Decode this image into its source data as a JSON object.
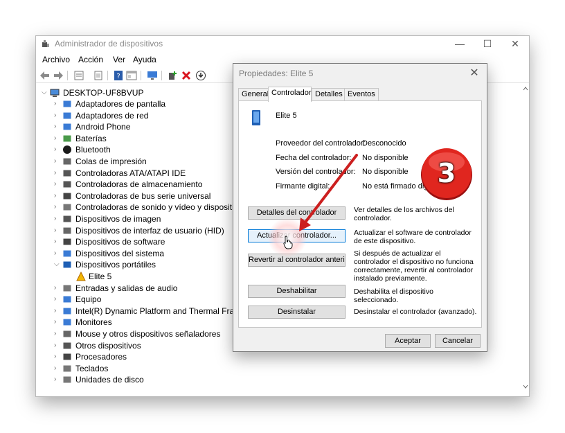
{
  "window": {
    "title": "Administrador de dispositivos",
    "minimize": "—",
    "maximize": "☐",
    "close": "✕"
  },
  "menu": [
    "Archivo",
    "Acción",
    "Ver",
    "Ayuda"
  ],
  "toolbar": {
    "icons": [
      "back-arrow-icon",
      "forward-arrow-icon",
      "properties-icon",
      "scan-icon",
      "help-icon",
      "view-icon",
      "monitor-icon",
      "add-driver-icon",
      "uninstall-icon",
      "update-icon"
    ]
  },
  "tree": {
    "root": "DESKTOP-UF8BVUP",
    "items": [
      {
        "label": "Adaptadores de pantalla",
        "icon": "display-adapter-icon",
        "expanded": false
      },
      {
        "label": "Adaptadores de red",
        "icon": "network-adapter-icon",
        "expanded": false
      },
      {
        "label": "Android Phone",
        "icon": "android-phone-icon",
        "expanded": false
      },
      {
        "label": "Baterías",
        "icon": "battery-icon",
        "expanded": false
      },
      {
        "label": "Bluetooth",
        "icon": "bluetooth-icon",
        "expanded": false
      },
      {
        "label": "Colas de impresión",
        "icon": "printer-icon",
        "expanded": false
      },
      {
        "label": "Controladoras ATA/ATAPI IDE",
        "icon": "ide-controller-icon",
        "expanded": false
      },
      {
        "label": "Controladoras de almacenamiento",
        "icon": "storage-controller-icon",
        "expanded": false
      },
      {
        "label": "Controladoras de bus serie universal",
        "icon": "usb-controller-icon",
        "expanded": false
      },
      {
        "label": "Controladoras de sonido y vídeo y dispositivos",
        "icon": "sound-icon",
        "expanded": false
      },
      {
        "label": "Dispositivos de imagen",
        "icon": "camera-icon",
        "expanded": false
      },
      {
        "label": "Dispositivos de interfaz de usuario (HID)",
        "icon": "hid-icon",
        "expanded": false
      },
      {
        "label": "Dispositivos de software",
        "icon": "software-device-icon",
        "expanded": false
      },
      {
        "label": "Dispositivos del sistema",
        "icon": "system-device-icon",
        "expanded": false
      },
      {
        "label": "Dispositivos portátiles",
        "icon": "portable-device-icon",
        "expanded": true
      },
      {
        "label": "Elite 5",
        "icon": "warning-device-icon",
        "child": true
      },
      {
        "label": "Entradas y salidas de audio",
        "icon": "speaker-icon",
        "expanded": false
      },
      {
        "label": "Equipo",
        "icon": "computer-icon",
        "expanded": false
      },
      {
        "label": "Intel(R) Dynamic Platform and Thermal Framework",
        "icon": "chip-icon",
        "expanded": false
      },
      {
        "label": "Monitores",
        "icon": "monitor-icon",
        "expanded": false
      },
      {
        "label": "Mouse y otros dispositivos señaladores",
        "icon": "mouse-icon",
        "expanded": false
      },
      {
        "label": "Otros dispositivos",
        "icon": "unknown-device-icon",
        "expanded": false
      },
      {
        "label": "Procesadores",
        "icon": "processor-icon",
        "expanded": false
      },
      {
        "label": "Teclados",
        "icon": "keyboard-icon",
        "expanded": false
      },
      {
        "label": "Unidades de disco",
        "icon": "disk-icon",
        "expanded": false
      }
    ]
  },
  "dialog": {
    "title": "Propiedades: Elite 5",
    "close": "✕",
    "tabs": [
      "General",
      "Controlador",
      "Detalles",
      "Eventos"
    ],
    "active_tab": "Controlador",
    "device_name": "Elite 5",
    "properties": [
      {
        "label": "Proveedor del controlador:",
        "value": "Desconocido"
      },
      {
        "label": "Fecha del controlador:",
        "value": "No disponible"
      },
      {
        "label": "Versión del controlador:",
        "value": "No disponible"
      },
      {
        "label": "Firmante digital:",
        "value": "No está firmado digitalmente"
      }
    ],
    "actions": [
      {
        "label": "Detalles del controlador",
        "desc": "Ver detalles de los archivos del controlador."
      },
      {
        "label": "Actualizar controlador...",
        "desc": "Actualizar el software de controlador de este dispositivo."
      },
      {
        "label": "Revertir al controlador anterior...",
        "desc": "Si después de actualizar el controlador el dispositivo no funciona correctamente, revertir al controlador instalado previamente."
      },
      {
        "label": "Deshabilitar",
        "desc": "Deshabilita el dispositivo seleccionado."
      },
      {
        "label": "Desinstalar",
        "desc": "Desinstalar el controlador (avanzado)."
      }
    ],
    "ok": "Aceptar",
    "cancel": "Cancelar"
  },
  "annotation": {
    "step": "3",
    "color": "#e0261f",
    "arrow_color": "#cc1f1f"
  }
}
